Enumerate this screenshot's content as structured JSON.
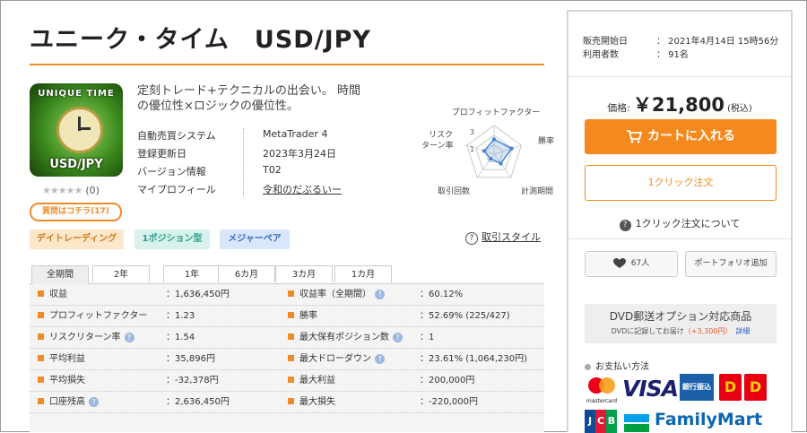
{
  "product": {
    "title": "ユニーク・タイム　USD/JPY",
    "image_text_top": "UNIQUE TIME",
    "image_text_bottom": "USD/JPY",
    "stars": "★★★★★",
    "review_count": "(0)",
    "rating": 0,
    "question_button": "質問はコチラ(17)",
    "tagline": "定刻トレード+テクニカルの出会い。 時間の優位性×ロジックの優位性。",
    "info": [
      {
        "key": "自動売買システム",
        "value": "MetaTrader 4"
      },
      {
        "key": "登録更新日",
        "value": "2023年3月24日"
      },
      {
        "key": "バージョン情報",
        "value": "T02"
      },
      {
        "key": "マイプロフィール",
        "value": "令和のだぶるいー"
      }
    ],
    "radar": {
      "labels": [
        "プロフィットファクター",
        "勝率",
        "計測期間",
        "取引回数",
        "リスク\nターン率"
      ],
      "label_line1": [
        "プロフィットファクター",
        "勝率",
        "計測期間",
        "取引回数",
        "リスク"
      ],
      "label_line2": "ターン率",
      "scale_marks": [
        "3",
        "1"
      ],
      "values": [
        2.6,
        3.2,
        2.0,
        1.0,
        1.8
      ],
      "max": 5
    },
    "tags": [
      "デイトレーディング",
      "1ポジション型",
      "メジャーペア"
    ],
    "style_link": "取引スタイル",
    "help_mark": "?"
  },
  "period_tabs": [
    "全期間",
    "2年",
    "1年",
    "6カ月",
    "3カ月",
    "1カ月"
  ],
  "active_tab": 0,
  "stats": {
    "left": [
      {
        "label": "収益",
        "value": "：1,636,450円",
        "help": false
      },
      {
        "label": "プロフィットファクター",
        "value": "：1.23",
        "help": false
      },
      {
        "label": "リスクリターン率",
        "value": "：1.54",
        "help": true
      },
      {
        "label": "平均利益",
        "value": "：35,896円",
        "help": false
      },
      {
        "label": "平均損失",
        "value": "：-32,378円",
        "help": false
      },
      {
        "label": "口座残高",
        "value": "：2,636,450円",
        "help": true
      }
    ],
    "right": [
      {
        "label": "収益率（全期間）",
        "value": "：60.12%",
        "help": true
      },
      {
        "label": "勝率",
        "value": "：52.69% (225/427)",
        "help": false
      },
      {
        "label": "最大保有ポジション数",
        "value": "：1",
        "help": true
      },
      {
        "label": "最大ドローダウン",
        "value": "：23.61% (1,064,230円)",
        "help": true
      },
      {
        "label": "最大利益",
        "value": "：200,000円",
        "help": false
      },
      {
        "label": "最大損失",
        "value": "：-220,000円",
        "help": false
      }
    ]
  },
  "sidebar": {
    "meta": [
      {
        "key": "販売開始日",
        "value": "：  2021年4月14日 15時56分"
      },
      {
        "key": "利用者数",
        "value": "：  91名"
      }
    ],
    "price_label": "価格:",
    "price_value": "￥21,800",
    "price_tax": "(税込)",
    "cart_button": "カートに入れる",
    "oneclick_button": "1クリック注文",
    "oneclick_help": "1クリック注文について",
    "like_count": "67人",
    "portfolio_button": "ポートフォリオ追加",
    "dvd_title": "DVD郵送オプション対応商品",
    "dvd_note": "DVDに記録してお届け",
    "dvd_price": "（+3,300円）",
    "dvd_detail": "詳細",
    "payment_title": "お支払い方法",
    "payment_logos": {
      "mastercard": "mastercard",
      "visa": "VISA",
      "bank": "銀行振込",
      "d1": "D",
      "d2": "D",
      "jcb": [
        "J",
        "C",
        "B"
      ],
      "familymart": "FamilyMart"
    },
    "accent_color": "#f5891d"
  }
}
